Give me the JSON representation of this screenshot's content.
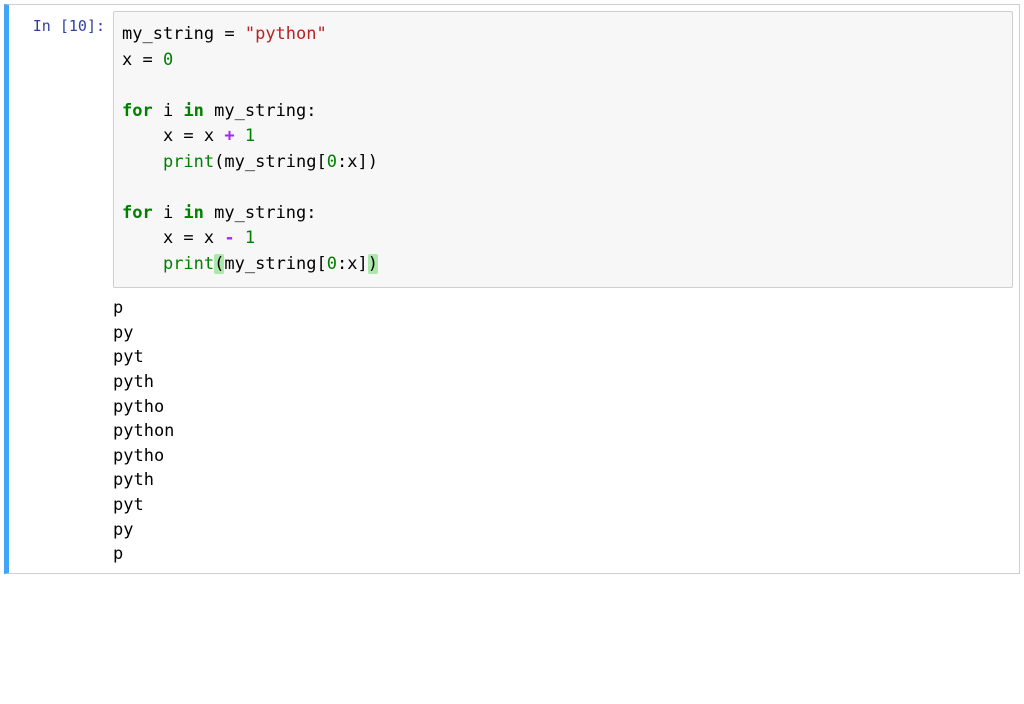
{
  "cell": {
    "prompt_prefix": "In [",
    "execution_count": "10",
    "prompt_suffix": "]:",
    "code": {
      "line1_var": "my_string",
      "line1_eq": " = ",
      "line1_str": "\"python\"",
      "line2": "x = ",
      "line2_num": "0",
      "blank1": "",
      "line3_for": "for",
      "line3_mid": " i ",
      "line3_in": "in",
      "line3_rest": " my_string:",
      "line4_indent": "    x = x ",
      "line4_op": "+",
      "line4_sp": " ",
      "line4_num": "1",
      "line5_indent": "    ",
      "line5_print": "print",
      "line5_paren1": "(my_string[",
      "line5_num0": "0",
      "line5_colon": ":x])",
      "blank2": "",
      "line6_for": "for",
      "line6_mid": " i ",
      "line6_in": "in",
      "line6_rest": " my_string:",
      "line7_indent": "    x = x ",
      "line7_op": "-",
      "line7_sp": " ",
      "line7_num": "1",
      "line8_indent": "    ",
      "line8_print": "print",
      "line8_paren1a": "(",
      "line8_paren1b": "my_string[",
      "line8_num0": "0",
      "line8_colon": ":x]",
      "line8_paren2": ")"
    },
    "output_lines": [
      "p",
      "py",
      "pyt",
      "pyth",
      "pytho",
      "python",
      "pytho",
      "pyth",
      "pyt",
      "py",
      "p"
    ]
  }
}
